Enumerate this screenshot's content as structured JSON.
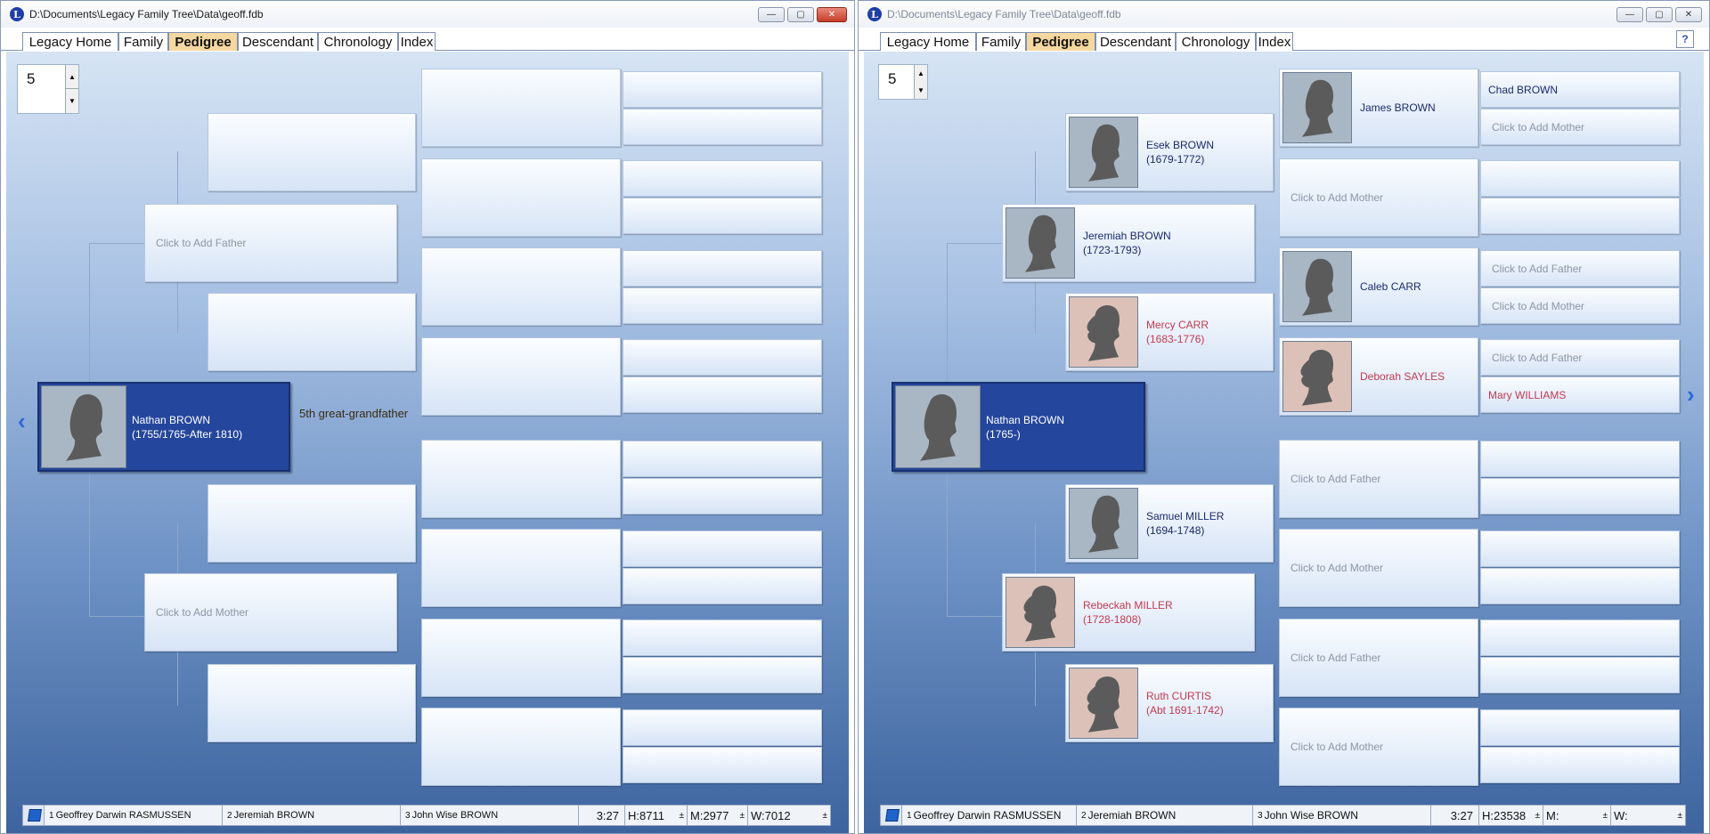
{
  "window1": {
    "title": "D:\\Documents\\Legacy Family Tree\\Data\\geoff.fdb",
    "buttons": {
      "minimize": "—",
      "maximize": "▢",
      "close": "✕"
    },
    "tabs": [
      "Legacy Home",
      "Family",
      "Pedigree",
      "Descendant",
      "Chronology",
      "Index"
    ],
    "active_tab": "Pedigree",
    "generations": "5",
    "root": {
      "name": "Nathan BROWN",
      "dates": "(1755/1765-After 1810)"
    },
    "relationship": "5th great-grandfather",
    "father_placeholder": "Click to Add Father",
    "mother_placeholder": "Click to Add Mother",
    "status": {
      "slot1_num": "1",
      "slot1_name": "Geoffrey Darwin RASMUSSEN",
      "slot2_num": "2",
      "slot2_name": "Jeremiah BROWN",
      "slot3_num": "3",
      "slot3_name": "John Wise BROWN",
      "time": "3:27",
      "h": "H:8711",
      "m": "M:2977",
      "w": "W:7012",
      "pm": "±"
    }
  },
  "window2": {
    "title": "D:\\Documents\\Legacy Family Tree\\Data\\geoff.fdb",
    "buttons": {
      "minimize": "—",
      "maximize": "▢",
      "close": "✕"
    },
    "tabs": [
      "Legacy Home",
      "Family",
      "Pedigree",
      "Descendant",
      "Chronology",
      "Index"
    ],
    "active_tab": "Pedigree",
    "help": "?",
    "generations": "5",
    "root": {
      "name": "Nathan BROWN",
      "dates": "(1765-)"
    },
    "gen1": [
      {
        "name": "Jeremiah BROWN",
        "dates": "(1723-1793)",
        "sex": "m"
      },
      {
        "name": "Rebeckah MILLER",
        "dates": "(1728-1808)",
        "sex": "f"
      }
    ],
    "gen2": [
      {
        "name": "Esek BROWN",
        "dates": "(1679-1772)",
        "sex": "m"
      },
      {
        "name": "Mercy CARR",
        "dates": "(1683-1776)",
        "sex": "f"
      },
      {
        "name": "Samuel MILLER",
        "dates": "(1694-1748)",
        "sex": "m"
      },
      {
        "name": "Ruth CURTIS",
        "dates": "(Abt 1691-1742)",
        "sex": "f"
      }
    ],
    "gen3": [
      {
        "name": "James BROWN",
        "sex": "m"
      },
      {
        "placeholder": "Click to Add Mother"
      },
      {
        "name": "Caleb CARR",
        "sex": "m"
      },
      {
        "name": "Deborah SAYLES",
        "sex": "f"
      },
      {
        "placeholder": "Click to Add Father"
      },
      {
        "placeholder": "Click to Add Mother"
      },
      {
        "placeholder": "Click to Add Father"
      },
      {
        "placeholder": "Click to Add Mother"
      }
    ],
    "gen4": [
      {
        "name": "Chad BROWN"
      },
      {
        "placeholder": "Click to Add Mother"
      },
      {},
      {},
      {
        "placeholder": "Click to Add Father"
      },
      {
        "placeholder": "Click to Add Mother"
      },
      {
        "placeholder": "Click to Add Father"
      },
      {
        "name": "Mary WILLIAMS",
        "sex": "f"
      },
      {},
      {},
      {},
      {},
      {},
      {},
      {},
      {}
    ],
    "status": {
      "slot1_num": "1",
      "slot1_name": "Geoffrey Darwin RASMUSSEN",
      "slot2_num": "2",
      "slot2_name": "Jeremiah BROWN",
      "slot3_num": "3",
      "slot3_name": "John Wise BROWN",
      "time": "3:27",
      "h": "H:23538",
      "m": "M:",
      "w": "W:",
      "pm": "±"
    }
  },
  "icons": [
    "app-icon",
    "minimize-icon",
    "maximize-icon",
    "close-icon",
    "spin-up-icon",
    "spin-down-icon",
    "nav-left-icon",
    "nav-right-icon",
    "book-icon",
    "help-icon",
    "silhouette-icon"
  ],
  "colors": {
    "active_tab": "#f5d7a0",
    "root_box": "#24469c",
    "female_name": "#c23a4f",
    "male_name": "#1c2a6b",
    "time_text": "#1f2fa8"
  }
}
